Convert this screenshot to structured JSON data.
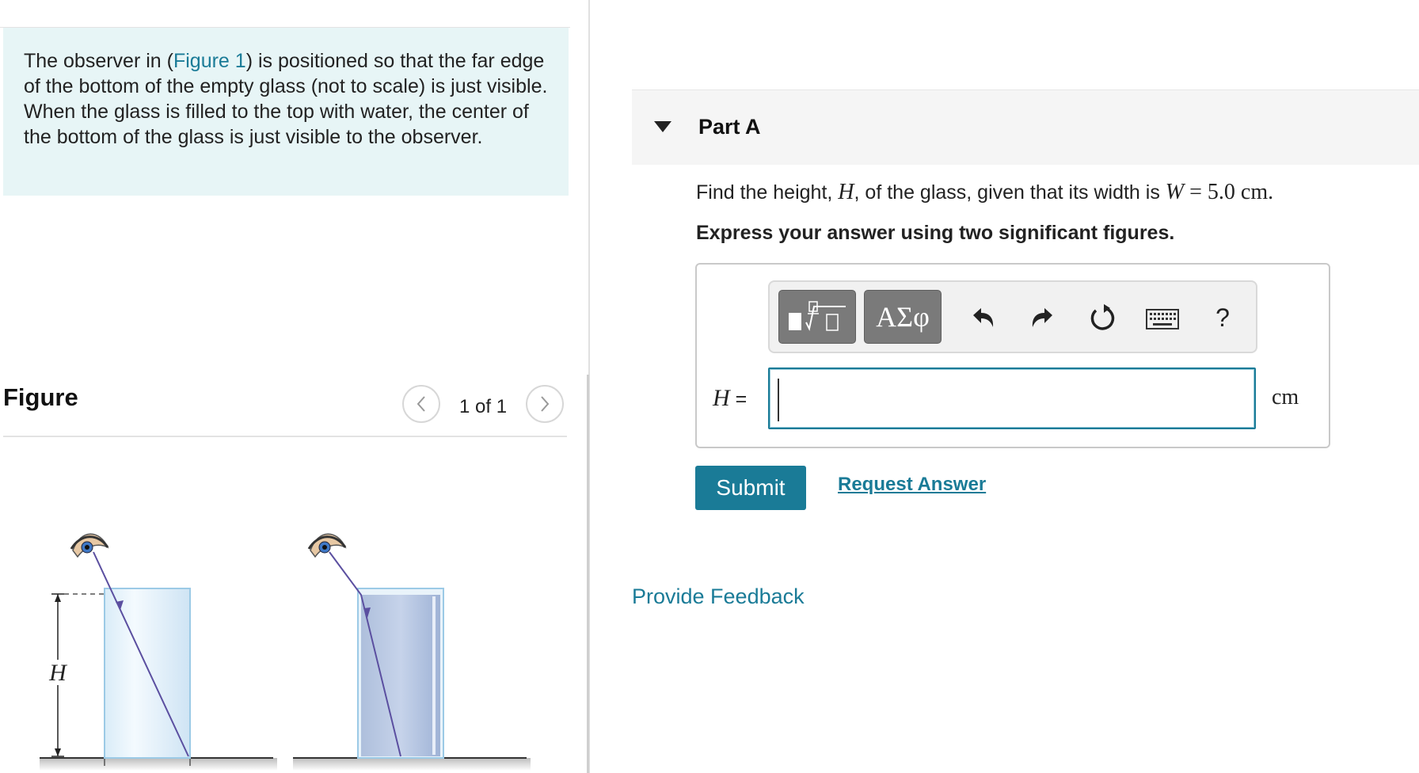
{
  "intro": {
    "text_before": "The observer in (",
    "figure_link": "Figure 1",
    "text_after": ") is positioned so that the far edge of the bottom of the empty glass (not to scale) is just visible. When the glass is filled to the top with water, the center of the bottom of the glass is just visible to the observer."
  },
  "figure_panel": {
    "title": "Figure",
    "prev_icon": "chevron-left-icon",
    "next_icon": "chevron-right-icon",
    "counter": "1 of 1",
    "height_label": "H"
  },
  "part": {
    "title": "Part A",
    "question_text": "Find the height, ",
    "question_var": "H",
    "question_mid": ", of the glass, given that its width is ",
    "question_width_var": "W",
    "question_width_val": " = 5.0 cm.",
    "instruction": "Express your answer using two significant figures."
  },
  "toolbar": {
    "templates_icon": "templates-sqrt-icon",
    "symbols_label": "ΑΣφ",
    "undo_icon": "undo-icon",
    "redo_icon": "redo-icon",
    "reset_icon": "reset-icon",
    "keyboard_icon": "keyboard-icon",
    "help_label": "?"
  },
  "answer": {
    "variable": "H",
    "equals": " =",
    "value": "",
    "unit": "cm"
  },
  "actions": {
    "submit_label": "Submit",
    "request_label": "Request Answer"
  },
  "footer": {
    "feedback_label": "Provide Feedback"
  },
  "colors": {
    "accent": "#1a7b97",
    "intro_bg": "#e7f5f6",
    "toolbar_dark": "#7a7a7a"
  }
}
